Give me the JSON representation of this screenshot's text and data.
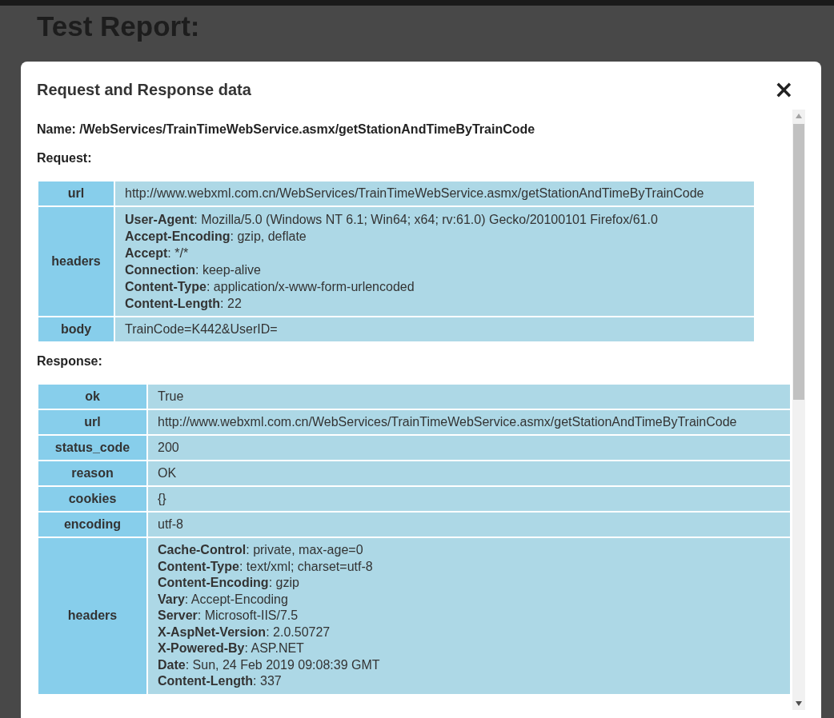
{
  "page": {
    "title": "Test Report:"
  },
  "modal": {
    "title": "Request and Response data",
    "close": "×",
    "name_line": "**Name:** /WebServices/TrainTimeWebService.asmx/getStationAndTimeByTrainCode",
    "sections": [
      {
        "title": "Request:",
        "rows": [
          {
            "key": "url",
            "kind": "text",
            "value": "http://www.webxml.com.cn/WebServices/TrainTimeWebService.asmx/getStationAndTimeByTrainCode"
          },
          {
            "key": "headers",
            "kind": "headers",
            "items": [
              {
                "name": "**User-Agent**:",
                "value": "Mozilla/5.0 (Windows NT 6.1; Win64; x64; rv:61.0) Gecko/20100101 Firefox/61.0"
              },
              {
                "name": "**Accept-Encoding**:",
                "value": "gzip, deflate"
              },
              {
                "name": "**Accept**:",
                "value": "*/*"
              },
              {
                "name": "**Connection**:",
                "value": "keep-alive"
              },
              {
                "name": "**Content-Type**:",
                "value": "application/x-www-form-urlencoded"
              },
              {
                "name": "**Content-Length**:",
                "value": "22"
              }
            ]
          },
          {
            "key": "body",
            "kind": "text",
            "value": "TrainCode=K442&UserID="
          }
        ]
      },
      {
        "title": "Response:",
        "rows": [
          {
            "key": "ok",
            "kind": "text",
            "value": "True"
          },
          {
            "key": "url",
            "kind": "text",
            "value": "http://www.webxml.com.cn/WebServices/TrainTimeWebService.asmx/getStationAndTimeByTrainCode"
          },
          {
            "key": "status_code",
            "kind": "text",
            "value": "200"
          },
          {
            "key": "reason",
            "kind": "text",
            "value": "OK"
          },
          {
            "key": "cookies",
            "kind": "text",
            "value": "{}"
          },
          {
            "key": "encoding",
            "kind": "text",
            "value": "utf-8"
          },
          {
            "key": "headers",
            "kind": "headers",
            "items": [
              {
                "name": "**Cache-Control**:",
                "value": "private, max-age=0"
              },
              {
                "name": "**Content-Type**:",
                "value": "text/xml; charset=utf-8"
              },
              {
                "name": "**Content-Encoding**:",
                "value": "gzip"
              },
              {
                "name": "**Vary**:",
                "value": "Accept-Encoding"
              },
              {
                "name": "**Server**:",
                "value": "Microsoft-IIS/7.5"
              },
              {
                "name": "**X-AspNet-Version**:",
                "value": "2.0.50727"
              },
              {
                "name": "**X-Powered-By**:",
                "value": "ASP.NET"
              },
              {
                "name": "**Date**:",
                "value": "Sun, 24 Feb 2019 09:08:39 GMT"
              },
              {
                "name": "**Content-Length**:",
                "value": "337"
              }
            ]
          }
        ]
      }
    ]
  }
}
